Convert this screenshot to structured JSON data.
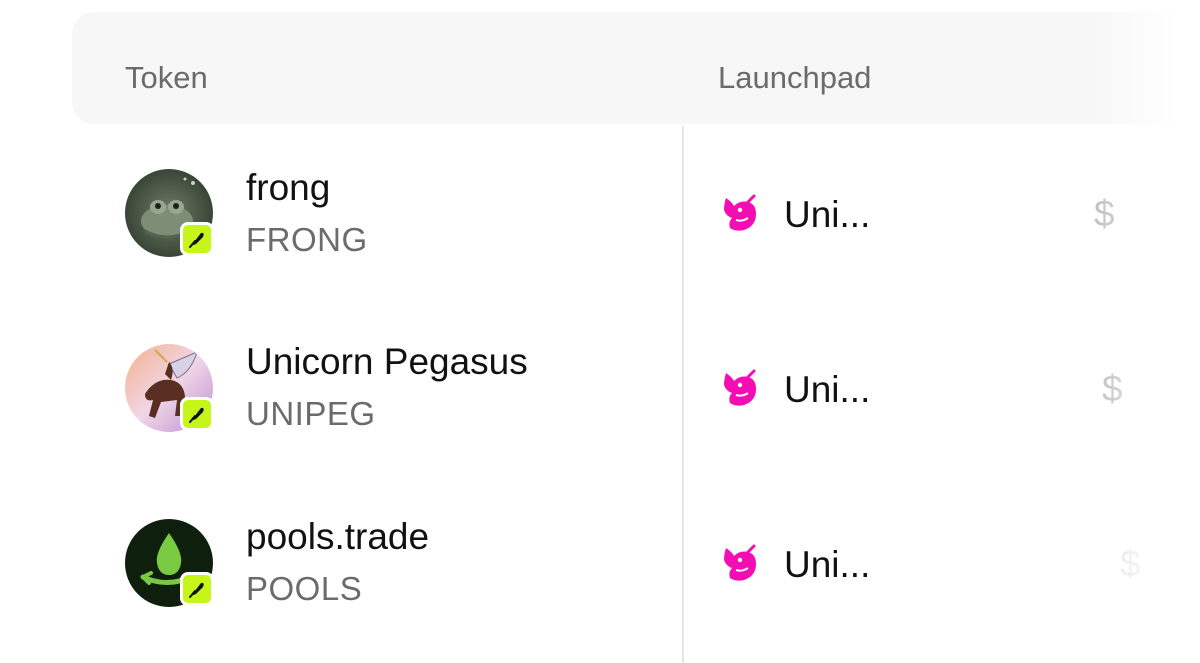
{
  "header": {
    "token_label": "Token",
    "launchpad_label": "Launchpad"
  },
  "rows": [
    {
      "name": "frong",
      "symbol": "FRONG",
      "launchpad": "Uni...",
      "price_prefix": "$",
      "avatar_icon": "frog-avatar",
      "badge_icon": "feather-icon"
    },
    {
      "name": "Unicorn Pegasus",
      "symbol": "UNIPEG",
      "launchpad": "Uni...",
      "price_prefix": "$",
      "avatar_icon": "pegasus-avatar",
      "badge_icon": "feather-icon"
    },
    {
      "name": "pools.trade",
      "symbol": "POOLS",
      "launchpad": "Uni...",
      "price_prefix": "$",
      "avatar_icon": "droplet-avatar",
      "badge_icon": "feather-icon"
    }
  ],
  "colors": {
    "badge": "#c6f51a",
    "uniswap_pink": "#f50db4",
    "header_bg": "#f7f7f7"
  }
}
